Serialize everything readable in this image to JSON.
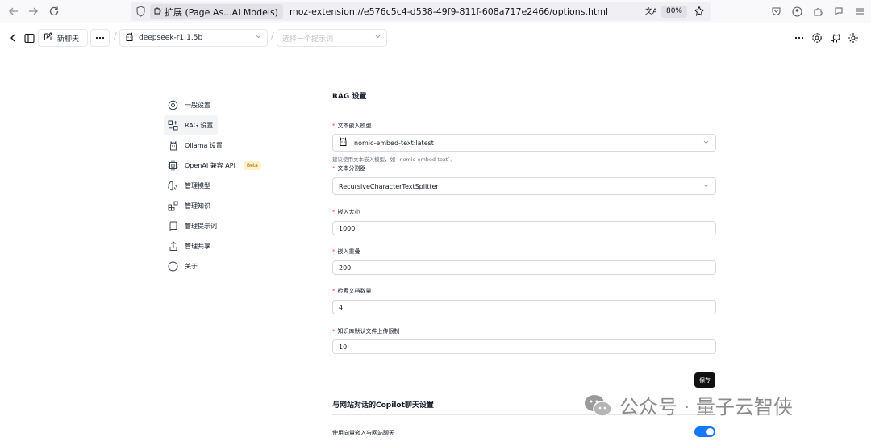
{
  "browser": {
    "tab_label": "扩展 (Page As...AI Models)",
    "url": "moz-extension://e576c5c4-d538-49f9-811f-608a717e2466/options.html",
    "zoom": "80%"
  },
  "header": {
    "new_chat": "新聊天",
    "model": "deepseek-r1:1.5b",
    "prompt_placeholder": "选择一个提示词"
  },
  "sidebar": {
    "items": [
      {
        "label": "一般设置",
        "icon": "settings-cog-icon"
      },
      {
        "label": "RAG 设置",
        "icon": "combine-icon"
      },
      {
        "label": "Ollama 设置",
        "icon": "ollama-icon"
      },
      {
        "label": "OpenAI 兼容 API",
        "icon": "cpu-icon",
        "badge": "Beta"
      },
      {
        "label": "管理模型",
        "icon": "brain-icon"
      },
      {
        "label": "管理知识",
        "icon": "blocks-icon"
      },
      {
        "label": "管理提示词",
        "icon": "book-icon"
      },
      {
        "label": "管理共享",
        "icon": "share-icon"
      },
      {
        "label": "关于",
        "icon": "info-icon"
      }
    ]
  },
  "rag": {
    "title": "RAG 设置",
    "embed_model_label": "文本嵌入模型",
    "embed_model_value": "nomic-embed-text:latest",
    "embed_model_hint": "建议使用文本嵌入模型，如 `nomic-embed-text`。",
    "splitter_label": "文本分割器",
    "splitter_value": "RecursiveCharacterTextSplitter",
    "chunk_size_label": "嵌入大小",
    "chunk_size_value": "1000",
    "chunk_overlap_label": "嵌入重叠",
    "chunk_overlap_value": "200",
    "doc_count_label": "检索文档数量",
    "doc_count_value": "4",
    "upload_limit_label": "知识库默认文件上传限制",
    "upload_limit_value": "10",
    "save": "保存",
    "required_mark": "*"
  },
  "copilot": {
    "title": "与网站对话的Copilot聊天设置",
    "vector_label": "使用向量嵌入与网站聊天",
    "vector_enabled": true
  },
  "watermark": {
    "text": "公众号 · 量子云智侠"
  },
  "colors": {
    "accent": "#1677ff",
    "required": "#ef4444",
    "save_bg": "#111111"
  }
}
